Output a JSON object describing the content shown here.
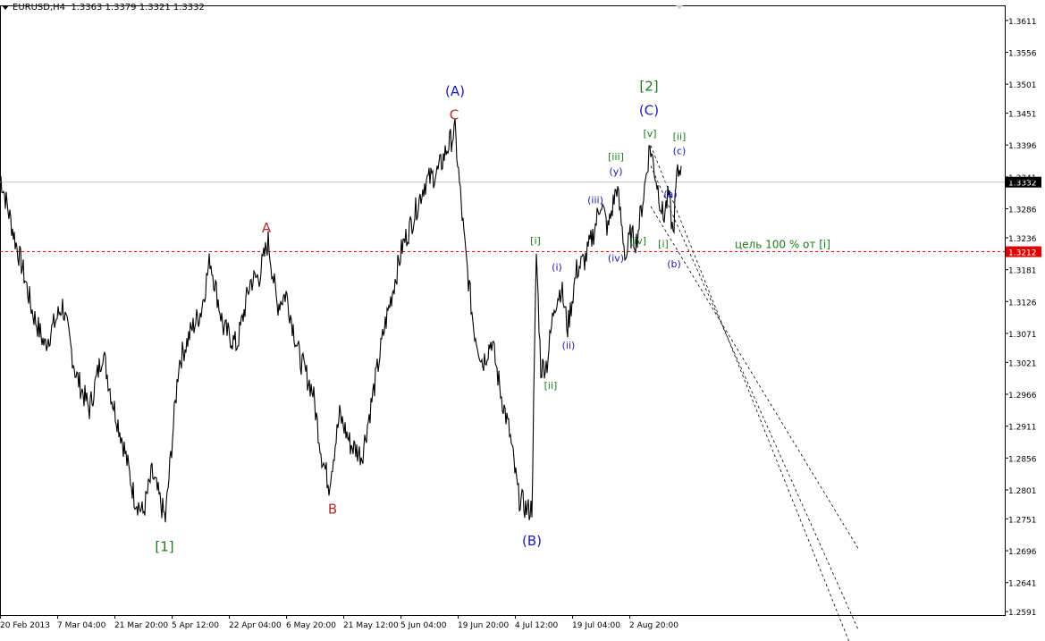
{
  "header": {
    "symbol": "EURUSD,H4",
    "ohlc": "1.3363 1.3379 1.3321 1.3332"
  },
  "colors": {
    "price": "#000000",
    "level": "#e00000",
    "blue": "#1a1ab8",
    "red": "#b52a2a",
    "green": "#1f7a1f",
    "grid_line": "#c0c0c0"
  },
  "chart_data": {
    "type": "line",
    "title": "",
    "xlabel": "",
    "ylabel": "",
    "ylim": [
      1.2585,
      1.3637
    ],
    "grid": false,
    "y_ticks": [
      "1.3611",
      "1.3556",
      "1.3501",
      "1.3451",
      "1.3396",
      "1.3341",
      "1.3286",
      "1.3236",
      "1.3181",
      "1.3126",
      "1.3071",
      "1.3021",
      "1.2966",
      "1.2911",
      "1.2856",
      "1.2801",
      "1.2751",
      "1.2696",
      "1.2641",
      "1.2591"
    ],
    "x_ticks": [
      "20 Feb 2013",
      "7 Mar 04:00",
      "21 Mar 20:00",
      "5 Apr 12:00",
      "22 Apr 04:00",
      "6 May 20:00",
      "21 May 12:00",
      "5 Jun 04:00",
      "19 Jun 20:00",
      "4 Jul 12:00",
      "19 Jul 04:00",
      "2 Aug 20:00"
    ],
    "x_tick_index": [
      0,
      64,
      128,
      192,
      256,
      320,
      384,
      448,
      512,
      576,
      640,
      704
    ],
    "series": [
      {
        "x_index": [
          0,
          18,
          25,
          36,
          50,
          70,
          85,
          100,
          115,
          125,
          138,
          150,
          160,
          170,
          185,
          200,
          215,
          225,
          235,
          250,
          265,
          280,
          290,
          300,
          310,
          320,
          335,
          350,
          360,
          368,
          380,
          392,
          405,
          420,
          430,
          440,
          450,
          460,
          475,
          490,
          500,
          509,
          520,
          530,
          540,
          550,
          560,
          570,
          580,
          590,
          595,
          600,
          605,
          612,
          620,
          628,
          635,
          645,
          655,
          665,
          672,
          680,
          690,
          700,
          705,
          712,
          720,
          727,
          735,
          742,
          748,
          753,
          757,
          762
        ],
        "y": [
          1.3345,
          1.3225,
          1.3185,
          1.311,
          1.305,
          1.312,
          1.3,
          1.294,
          1.304,
          1.296,
          1.288,
          1.279,
          1.276,
          1.283,
          1.275,
          1.302,
          1.308,
          1.311,
          1.32,
          1.308,
          1.305,
          1.316,
          1.317,
          1.323,
          1.312,
          1.314,
          1.303,
          1.297,
          1.286,
          1.281,
          1.293,
          1.288,
          1.286,
          1.299,
          1.308,
          1.315,
          1.322,
          1.326,
          1.333,
          1.335,
          1.339,
          1.342,
          1.322,
          1.308,
          1.302,
          1.306,
          1.297,
          1.29,
          1.279,
          1.2765,
          1.277,
          1.321,
          1.301,
          1.302,
          1.312,
          1.315,
          1.308,
          1.318,
          1.32,
          1.325,
          1.33,
          1.325,
          1.3325,
          1.32,
          1.324,
          1.323,
          1.331,
          1.3395,
          1.333,
          1.327,
          1.331,
          1.324,
          1.334,
          1.336
        ]
      }
    ],
    "level_line": {
      "value": 1.3212,
      "label": "цель 100 % от [i]"
    },
    "current_line": {
      "value": 1.3332
    },
    "price_tags": [
      "1.3332",
      "1.3212"
    ],
    "channel": {
      "start_index": 728,
      "start_values": [
        1.3395,
        1.336,
        1.329
      ],
      "end_index": 960,
      "end_values": [
        1.25,
        1.256,
        1.27
      ]
    },
    "annotations": [
      {
        "text": "[1]",
        "x_index": 184,
        "y": 1.2695,
        "color": "green",
        "size": 15
      },
      {
        "text": "A",
        "x_index": 298,
        "y": 1.3245,
        "color": "red",
        "size": 15
      },
      {
        "text": "B",
        "x_index": 372,
        "y": 1.276,
        "color": "red",
        "size": 15
      },
      {
        "text": "(A)",
        "x_index": 509,
        "y": 1.3481,
        "color": "blue",
        "size": 15
      },
      {
        "text": "C",
        "x_index": 508,
        "y": 1.344,
        "color": "red",
        "size": 15
      },
      {
        "text": "(B)",
        "x_index": 595,
        "y": 1.2705,
        "color": "blue",
        "size": 15
      },
      {
        "text": "[i]",
        "x_index": 599,
        "y": 1.3225,
        "color": "green",
        "size": 11
      },
      {
        "text": "[ii]",
        "x_index": 616,
        "y": 1.2975,
        "color": "green",
        "size": 11
      },
      {
        "text": "(i)",
        "x_index": 623,
        "y": 1.318,
        "color": "blue",
        "size": 11
      },
      {
        "text": "(ii)",
        "x_index": 636,
        "y": 1.3045,
        "color": "blue",
        "size": 11
      },
      {
        "text": "(iii)",
        "x_index": 666,
        "y": 1.3295,
        "color": "blue",
        "size": 11
      },
      {
        "text": "[iii]",
        "x_index": 689,
        "y": 1.337,
        "color": "green",
        "size": 11
      },
      {
        "text": "(y)",
        "x_index": 689,
        "y": 1.3345,
        "color": "blue",
        "size": 11
      },
      {
        "text": "(iv)",
        "x_index": 689,
        "y": 1.3195,
        "color": "blue",
        "size": 11
      },
      {
        "text": "[iv]",
        "x_index": 714,
        "y": 1.3225,
        "color": "green",
        "size": 11
      },
      {
        "text": "[2]",
        "x_index": 726,
        "y": 1.349,
        "color": "green",
        "size": 15
      },
      {
        "text": "(C)",
        "x_index": 726,
        "y": 1.3448,
        "color": "blue",
        "size": 15
      },
      {
        "text": "[v]",
        "x_index": 727,
        "y": 1.341,
        "color": "green",
        "size": 11
      },
      {
        "text": "[ii]",
        "x_index": 760,
        "y": 1.3405,
        "color": "green",
        "size": 11
      },
      {
        "text": "(c)",
        "x_index": 760,
        "y": 1.338,
        "color": "blue",
        "size": 11
      },
      {
        "text": "(a)",
        "x_index": 750,
        "y": 1.3305,
        "color": "blue",
        "size": 11
      },
      {
        "text": "[i]",
        "x_index": 742,
        "y": 1.322,
        "color": "green",
        "size": 11
      },
      {
        "text": "(b)",
        "x_index": 754,
        "y": 1.3185,
        "color": "blue",
        "size": 11
      }
    ]
  }
}
